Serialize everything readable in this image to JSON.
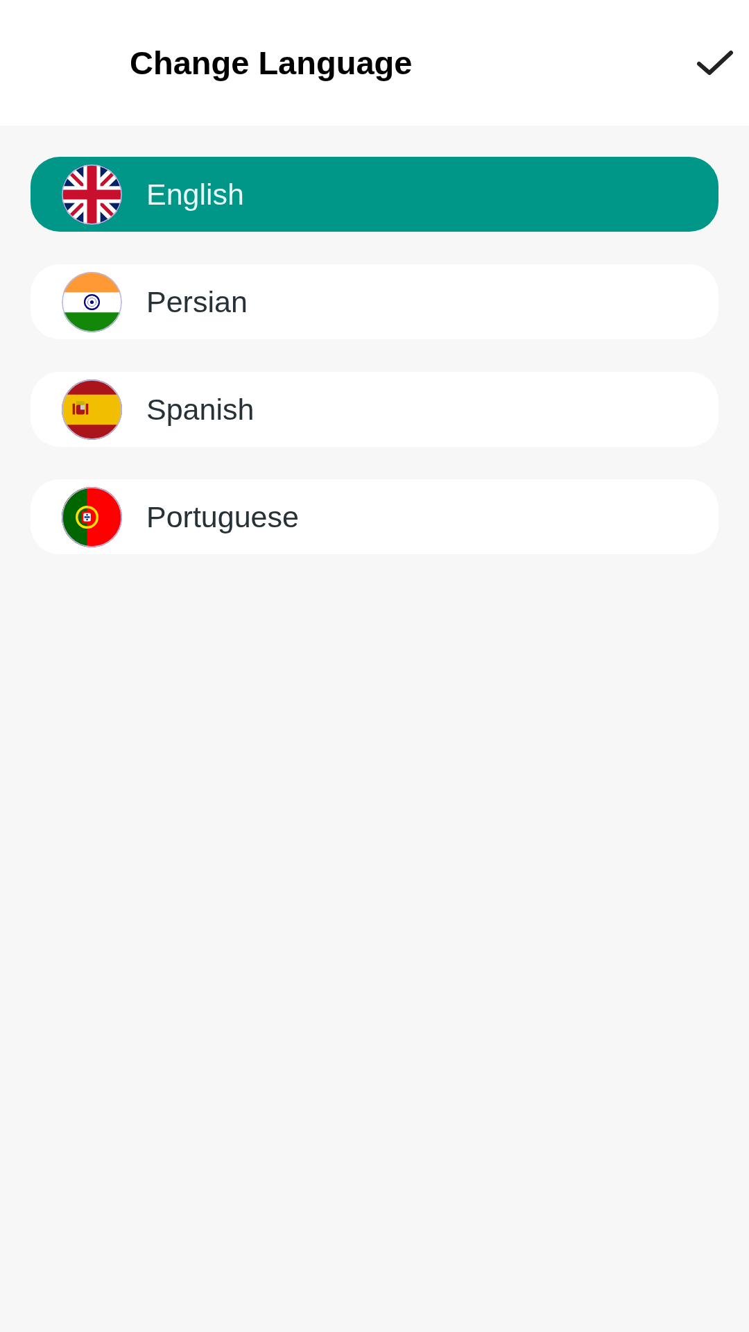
{
  "header": {
    "title": "Change Language"
  },
  "languages": [
    {
      "name": "English",
      "kind": "uk",
      "selected": true
    },
    {
      "name": "Persian",
      "kind": "india",
      "selected": false
    },
    {
      "name": "Spanish",
      "kind": "spain",
      "selected": false
    },
    {
      "name": "Portuguese",
      "kind": "portugal",
      "selected": false
    }
  ]
}
